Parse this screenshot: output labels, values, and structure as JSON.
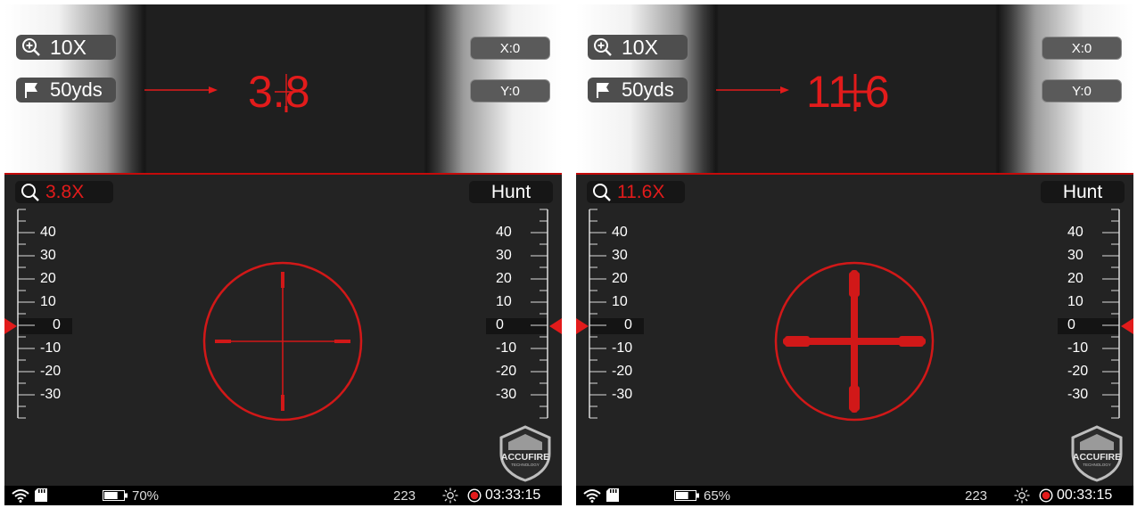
{
  "panels": [
    {
      "id": "left",
      "top": {
        "zoom_label": "10X",
        "distance_label": "50yds",
        "x_offset": "X:0",
        "y_offset": "Y:0",
        "magnified_zoom_text": "3.8"
      },
      "zoom_badge": "3.8X",
      "mode": "Hunt",
      "reticle_style": "thin",
      "status": {
        "battery_percent": "70%",
        "battery_level": 0.7,
        "shot_count": "223",
        "recording_time": "03:33:15"
      }
    },
    {
      "id": "right",
      "top": {
        "zoom_label": "10X",
        "distance_label": "50yds",
        "x_offset": "X:0",
        "y_offset": "Y:0",
        "magnified_zoom_text": "11.6"
      },
      "zoom_badge": "11.6X",
      "mode": "Hunt",
      "reticle_style": "thick",
      "status": {
        "battery_percent": "65%",
        "battery_level": 0.65,
        "shot_count": "223",
        "recording_time": "00:33:15"
      }
    }
  ],
  "scale_labels": [
    "40",
    "30",
    "20",
    "10",
    "0",
    "-10",
    "-20",
    "-30"
  ],
  "logo_text": "ACCUFIRE",
  "logo_subtext": "TECHNOLOGY",
  "icons": {
    "zoom": "zoom-in-icon",
    "distance": "flag-icon",
    "zoom_badge": "magnifier-icon",
    "wifi": "wifi-icon",
    "sd": "sd-card-icon",
    "battery": "battery-icon",
    "brightness": "sun-icon",
    "record": "record-icon"
  },
  "colors": {
    "accent": "#e21b1b",
    "background": "#232323",
    "pill": "#4e4e4e"
  }
}
